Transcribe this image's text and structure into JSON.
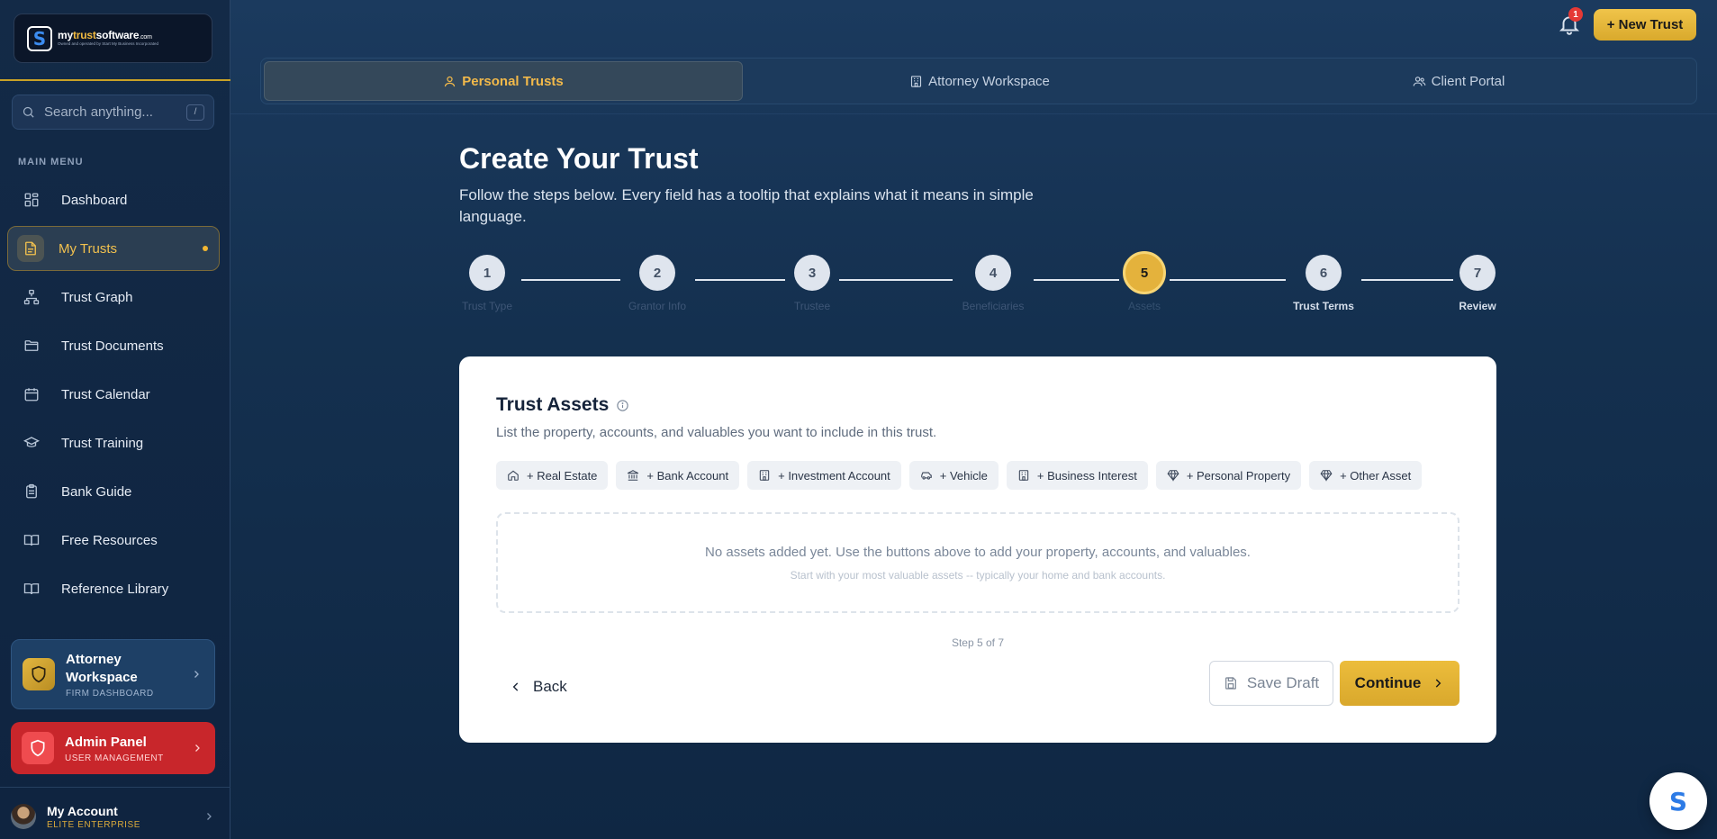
{
  "brand": {
    "logo_letter": "S",
    "name_part1": "my",
    "name_part2": "trust",
    "name_part3": "software",
    "name_domain": ".com",
    "tagline": "Owned and operated by Start My Business Incorporated"
  },
  "search": {
    "placeholder": "Search anything...",
    "shortcut": "/"
  },
  "sidebar": {
    "section_label": "MAIN MENU",
    "items": [
      {
        "label": "Dashboard",
        "icon": "grid-icon"
      },
      {
        "label": "My Trusts",
        "icon": "document-icon",
        "active": true
      },
      {
        "label": "Trust Graph",
        "icon": "graph-icon"
      },
      {
        "label": "Trust Documents",
        "icon": "folder-icon"
      },
      {
        "label": "Trust Calendar",
        "icon": "calendar-icon"
      },
      {
        "label": "Trust Training",
        "icon": "graduation-cap-icon"
      },
      {
        "label": "Bank Guide",
        "icon": "clipboard-icon"
      },
      {
        "label": "Free Resources",
        "icon": "book-icon"
      },
      {
        "label": "Reference Library",
        "icon": "book-open-icon"
      }
    ],
    "attorney": {
      "title": "Attorney Workspace",
      "subtitle": "FIRM DASHBOARD"
    },
    "admin": {
      "title": "Admin Panel",
      "subtitle": "USER MANAGEMENT"
    },
    "account": {
      "name": "My Account",
      "tier": "ELITE ENTERPRISE"
    }
  },
  "topbar": {
    "notification_count": "1",
    "new_trust_label": "+ New Trust",
    "tabs": [
      {
        "label": "Personal Trusts",
        "active": true
      },
      {
        "label": "Attorney Workspace"
      },
      {
        "label": "Client Portal"
      }
    ]
  },
  "main": {
    "title": "Create Your Trust",
    "subtitle": "Follow the steps below. Every field has a tooltip that explains what it means in simple language.",
    "steps": [
      {
        "num": "1",
        "label": "Trust Type"
      },
      {
        "num": "2",
        "label": "Grantor Info"
      },
      {
        "num": "3",
        "label": "Trustee"
      },
      {
        "num": "4",
        "label": "Beneficiaries"
      },
      {
        "num": "5",
        "label": "Assets"
      },
      {
        "num": "6",
        "label": "Trust Terms"
      },
      {
        "num": "7",
        "label": "Review"
      }
    ],
    "current_step": 5,
    "panel": {
      "title": "Trust Assets",
      "subtitle": "List the property, accounts, and valuables you want to include in this trust.",
      "asset_buttons": [
        {
          "label": "+ Real Estate",
          "icon": "home-icon"
        },
        {
          "label": "+ Bank Account",
          "icon": "bank-icon"
        },
        {
          "label": "+ Investment Account",
          "icon": "building-icon"
        },
        {
          "label": "+ Vehicle",
          "icon": "car-icon"
        },
        {
          "label": "+ Business Interest",
          "icon": "building-icon"
        },
        {
          "label": "+ Personal Property",
          "icon": "gem-icon"
        },
        {
          "label": "+ Other Asset",
          "icon": "gem-icon"
        }
      ],
      "empty_primary": "No assets added yet. Use the buttons above to add your property, accounts, and valuables.",
      "empty_secondary": "Start with your most valuable assets -- typically your home and bank accounts.",
      "step_counter": "Step 5 of 7",
      "back_label": "Back",
      "save_label": "Save Draft",
      "continue_label": "Continue"
    }
  },
  "colors": {
    "accent": "#e4b23c",
    "sidebar": "#132a47",
    "danger": "#c8262b"
  }
}
